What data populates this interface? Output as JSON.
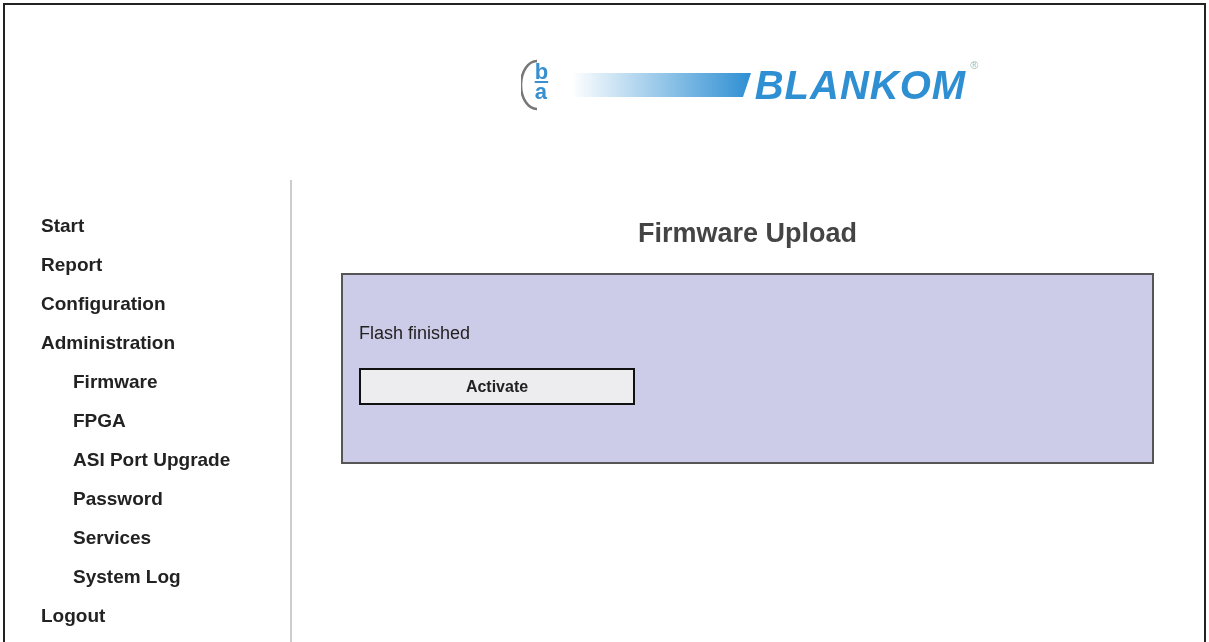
{
  "logo": {
    "mark_top": "b",
    "mark_bottom": "a",
    "name": "BLANKOM",
    "registered": "®"
  },
  "menu": [
    {
      "label": "Start"
    },
    {
      "label": "Report"
    },
    {
      "label": "Configuration"
    },
    {
      "label": "Administration",
      "children": [
        {
          "label": "Firmware"
        },
        {
          "label": "FPGA"
        },
        {
          "label": "ASI Port Upgrade"
        },
        {
          "label": "Password"
        },
        {
          "label": "Services"
        },
        {
          "label": "System Log"
        }
      ]
    },
    {
      "label": "Logout"
    }
  ],
  "page_title": "Firmware Upload",
  "panel": {
    "message": "Flash finished",
    "button": "Activate"
  }
}
